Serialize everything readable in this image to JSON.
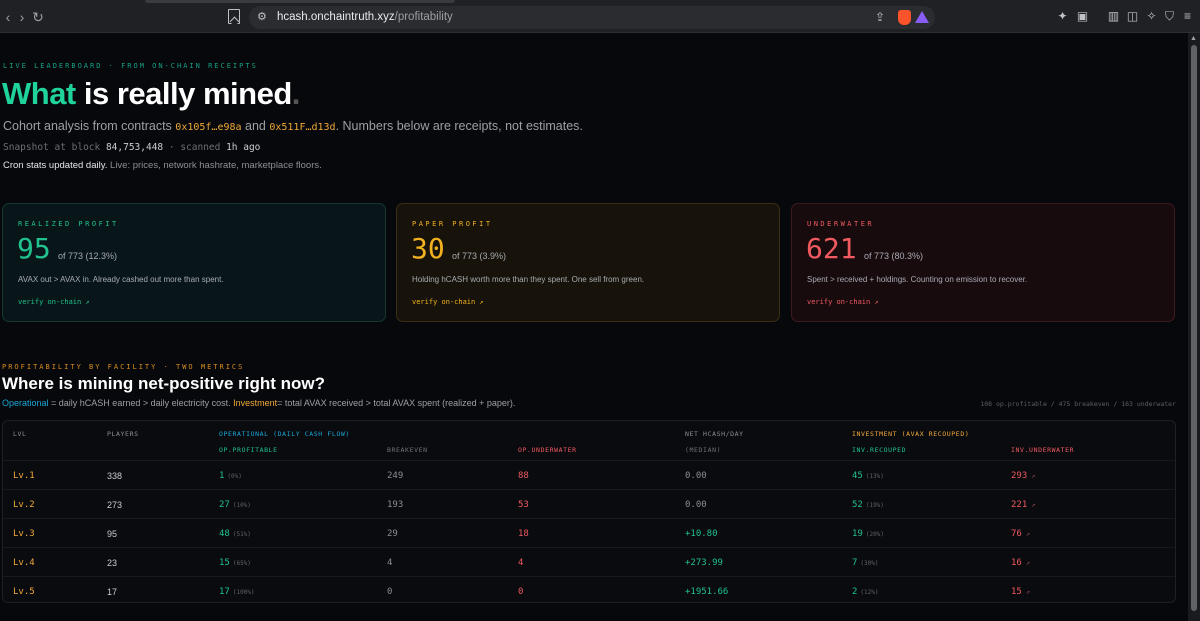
{
  "browser": {
    "url_host": "hcash.onchaintruth.xyz",
    "url_path": "/profitability"
  },
  "hero": {
    "eyebrow": "LIVE LEADERBOARD · FROM ON-CHAIN RECEIPTS",
    "title_accent": "What",
    "title_rest": " is really mined",
    "title_dot": ".",
    "sub_prefix": "Cohort analysis from contracts ",
    "addr1": "0x105f…e98a",
    "sub_and": " and ",
    "addr2": "0x511F…d13d",
    "sub_suffix": ". Numbers below are receipts, not estimates.",
    "snapshot_label": "Snapshot at block ",
    "block": "84,753,448",
    "scanned_label": " · scanned ",
    "scanned": "1h ago",
    "cron_bold": "Cron stats updated daily.",
    "cron_rest": " Live: prices, network hashrate, marketplace floors."
  },
  "cards": [
    {
      "label": "REALIZED PROFIT",
      "value": "95",
      "of": "of 773 (12.3%)",
      "desc": "AVAX out > AVAX in. Already cashed out more than spent.",
      "verify": "verify on-chain ↗"
    },
    {
      "label": "PAPER PROFIT",
      "value": "30",
      "of": "of 773 (3.9%)",
      "desc": "Holding hCASH worth more than they spent. One sell from green.",
      "verify": "verify on-chain ↗"
    },
    {
      "label": "UNDERWATER",
      "value": "621",
      "of": "of 773 (80.3%)",
      "desc": "Spent > received + holdings. Counting on emission to recover.",
      "verify": "verify on-chain ↗"
    }
  ],
  "section": {
    "eyebrow": "PROFITABILITY BY FACILITY · TWO METRICS",
    "title": "Where is mining net-positive right now?",
    "op_label": "Operational",
    "op_desc": " = daily hCASH earned > daily electricity cost. ",
    "inv_label": "Investment",
    "inv_desc": "= total AVAX received > total AVAX spent (realized + paper).",
    "stats": "108 op.profitable / 475 breakeven / 163 underwater"
  },
  "table": {
    "headers": {
      "lvl": "LVL",
      "players": "PLAYERS",
      "operational": "OPERATIONAL (DAILY CASH FLOW)",
      "op_profitable": "OP.PROFITABLE",
      "breakeven": "BREAKEVEN",
      "op_underwater": "OP.UNDERWATER",
      "net": "NET HCASH/DAY",
      "median": "(MEDIAN)",
      "investment": "INVESTMENT (AVAX RECOUPED)",
      "inv_recouped": "INV.RECOUPED",
      "inv_underwater": "INV.UNDERWATER"
    },
    "rows": [
      {
        "lvl": "Lv.1",
        "players": "338",
        "op_prof": "1",
        "op_prof_pct": "(0%)",
        "breakeven": "249",
        "op_under": "88",
        "net": "0.00",
        "net_pos": false,
        "inv_rec": "45",
        "inv_rec_pct": "(13%)",
        "inv_under": "293",
        "arrow": "↗"
      },
      {
        "lvl": "Lv.2",
        "players": "273",
        "op_prof": "27",
        "op_prof_pct": "(10%)",
        "breakeven": "193",
        "op_under": "53",
        "net": "0.00",
        "net_pos": false,
        "inv_rec": "52",
        "inv_rec_pct": "(19%)",
        "inv_under": "221",
        "arrow": "↗"
      },
      {
        "lvl": "Lv.3",
        "players": "95",
        "op_prof": "48",
        "op_prof_pct": "(51%)",
        "breakeven": "29",
        "op_under": "18",
        "net": "+10.80",
        "net_pos": true,
        "inv_rec": "19",
        "inv_rec_pct": "(20%)",
        "inv_under": "76",
        "arrow": "↗"
      },
      {
        "lvl": "Lv.4",
        "players": "23",
        "op_prof": "15",
        "op_prof_pct": "(65%)",
        "breakeven": "4",
        "op_under": "4",
        "net": "+273.99",
        "net_pos": true,
        "inv_rec": "7",
        "inv_rec_pct": "(30%)",
        "inv_under": "16",
        "arrow": "↗"
      },
      {
        "lvl": "Lv.5",
        "players": "17",
        "op_prof": "17",
        "op_prof_pct": "(100%)",
        "breakeven": "0",
        "op_under": "0",
        "net": "+1951.66",
        "net_pos": true,
        "inv_rec": "2",
        "inv_rec_pct": "(12%)",
        "inv_under": "15",
        "arrow": "↗"
      }
    ]
  },
  "colors": {
    "accent_green": "#1fd39b",
    "amber": "#f2b21f",
    "red": "#ef5a60",
    "blue": "#1ba6d6",
    "background": "#07080c"
  }
}
